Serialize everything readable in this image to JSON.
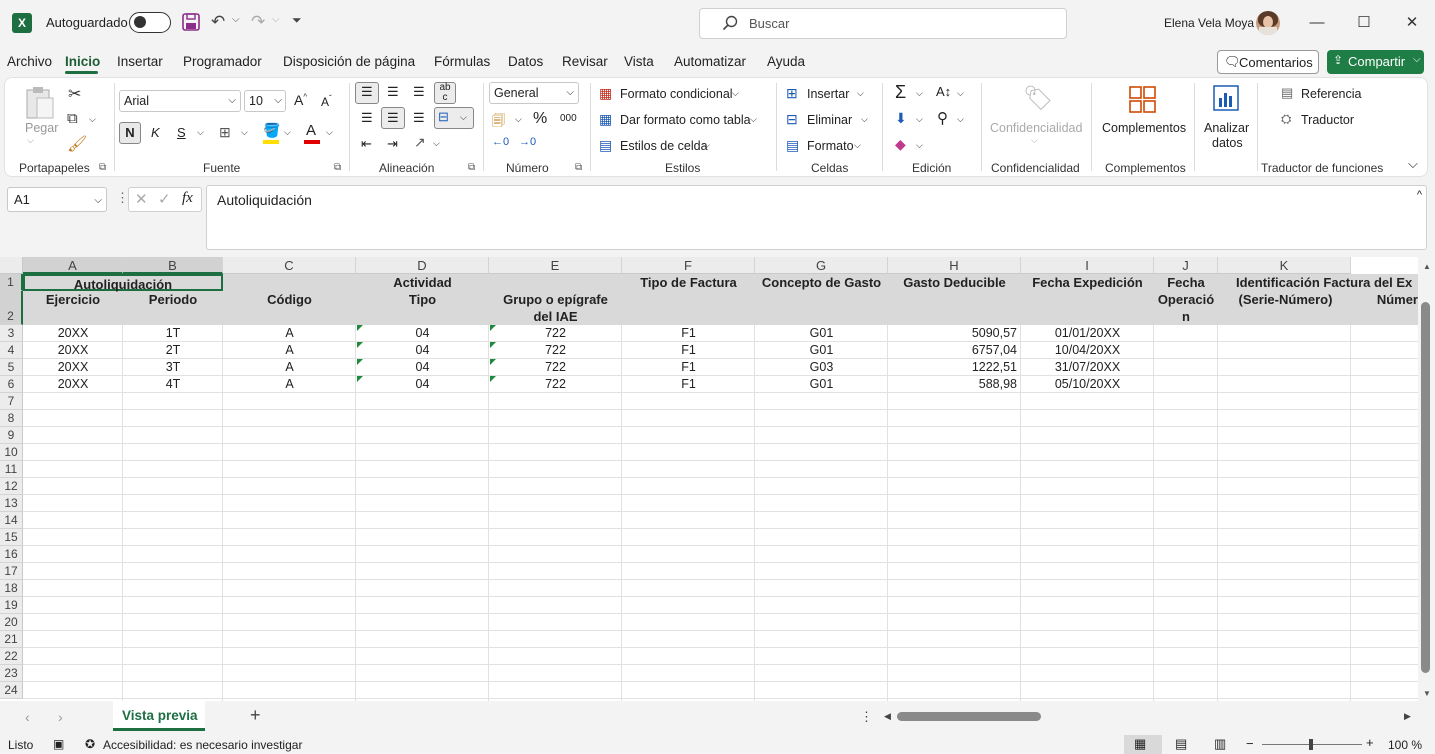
{
  "titlebar": {
    "autosave_label": "Autoguardado",
    "search_placeholder": "Buscar",
    "user_name": "Elena Vela Moya"
  },
  "menu": [
    "Archivo",
    "Inicio",
    "Insertar",
    "Programador",
    "Disposición de página",
    "Fórmulas",
    "Datos",
    "Revisar",
    "Vista",
    "Automatizar",
    "Ayuda"
  ],
  "menu_active": "Inicio",
  "comments_label": "Comentarios",
  "share_label": "Compartir",
  "ribbon": {
    "clipboard": {
      "paste": "Pegar",
      "group": "Portapapeles"
    },
    "font": {
      "name": "Arial",
      "size": "10",
      "bold": "N",
      "italic": "K",
      "underline": "S",
      "group": "Fuente"
    },
    "alignment": {
      "group": "Alineación"
    },
    "number": {
      "format": "General",
      "percent": "%",
      "thousands": "000",
      "group": "Número"
    },
    "styles": {
      "conditional": "Formato condicional",
      "as_table": "Dar formato como tabla",
      "cell_styles": "Estilos de celda",
      "group": "Estilos"
    },
    "cells": {
      "insert": "Insertar",
      "delete": "Eliminar",
      "format": "Formato",
      "group": "Celdas"
    },
    "editing": {
      "group": "Edición"
    },
    "confidentiality": {
      "button": "Confidencialidad",
      "group": "Confidencialidad"
    },
    "addins": {
      "button": "Complementos",
      "group": "Complementos"
    },
    "analyze": {
      "line1": "Analizar",
      "line2": "datos"
    },
    "translator": {
      "reference": "Referencia",
      "translate": "Traductor",
      "group": "Traductor de funciones"
    }
  },
  "formula_bar": {
    "cell_ref": "A1",
    "fx": "fx",
    "content": "Autoliquidación"
  },
  "columns": [
    "A",
    "B",
    "C",
    "D",
    "E",
    "F",
    "G",
    "H",
    "I",
    "J",
    "K"
  ],
  "rows_visible": [
    "1",
    "2",
    "3",
    "4",
    "5",
    "6",
    "7",
    "8",
    "9",
    "10",
    "11",
    "12",
    "13",
    "14",
    "15",
    "16",
    "17",
    "18",
    "19",
    "20",
    "21",
    "22",
    "23",
    "24"
  ],
  "sheet": {
    "merged_title": "Autoliquidación",
    "headers": {
      "A": "Ejercicio",
      "B": "Periodo",
      "C": "Código",
      "D1": "Actividad",
      "D2": "Tipo",
      "E1": "Grupo o epígrafe",
      "E2": "del IAE",
      "F": "Tipo de Factura",
      "G": "Concepto de Gasto",
      "H": "Gasto Deducible",
      "I": "Fecha Expedición",
      "J1": "Fecha",
      "J2": "Operació",
      "J3": "n",
      "K1": "Identificación Factura del Ex",
      "K2": "(Serie-Número)",
      "K3": "Númer"
    },
    "rows": [
      {
        "A": "20XX",
        "B": "1T",
        "C": "A",
        "D": "04",
        "E": "722",
        "F": "F1",
        "G": "G01",
        "H": "5090,57",
        "I": "01/01/20XX"
      },
      {
        "A": "20XX",
        "B": "2T",
        "C": "A",
        "D": "04",
        "E": "722",
        "F": "F1",
        "G": "G01",
        "H": "6757,04",
        "I": "10/04/20XX"
      },
      {
        "A": "20XX",
        "B": "3T",
        "C": "A",
        "D": "04",
        "E": "722",
        "F": "F1",
        "G": "G03",
        "H": "1222,51",
        "I": "31/07/20XX"
      },
      {
        "A": "20XX",
        "B": "4T",
        "C": "A",
        "D": "04",
        "E": "722",
        "F": "F1",
        "G": "G01",
        "H": "588,98",
        "I": "05/10/20XX"
      }
    ]
  },
  "sheet_tab": "Vista previa",
  "status": {
    "ready": "Listo",
    "accessibility": "Accesibilidad: es necesario investigar",
    "zoom": "100 %"
  },
  "colors": {
    "excel_green": "#1d6f42",
    "share_green": "#1e7e45",
    "header_fill": "#d9d9d9"
  }
}
